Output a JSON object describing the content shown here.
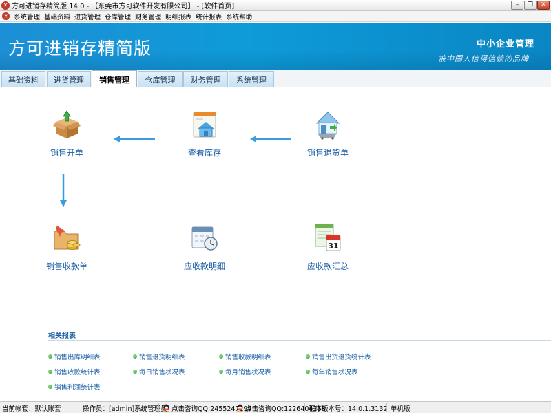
{
  "window": {
    "title": "方可进销存精简版 14.0 - 【东莞市方可软件开发有限公司】 - [软件首页]"
  },
  "menu": [
    "系统管理",
    "基础资料",
    "进货管理",
    "仓库管理",
    "财务管理",
    "明细报表",
    "统计报表",
    "系统帮助"
  ],
  "banner": {
    "title": "方可进销存精简版",
    "slogan_main": "中小企业管理",
    "slogan_sub": "被中国人信得信赖的品牌"
  },
  "tabs": [
    "基础资料",
    "进货管理",
    "销售管理",
    "仓库管理",
    "财务管理",
    "系统管理"
  ],
  "active_tab": "销售管理",
  "modules": {
    "sales_order": "销售开单",
    "stock_view": "查看库存",
    "sales_return": "销售退货单",
    "sales_receipt": "销售收款单",
    "receivable_detail": "应收款明细",
    "receivable_summary": "应收款汇总"
  },
  "reports": {
    "title": "相关报表",
    "items": [
      "销售出库明细表",
      "销售退货明细表",
      "销售收款明细表",
      "销售出货退货统计表",
      "销售收款统计表",
      "每日销售状况表",
      "每月销售状况表",
      "每年销售状况表",
      "销售利润统计表"
    ]
  },
  "status": {
    "account": "当前帐套：默认账套",
    "operator": "操作员：[admin]系统管理员",
    "qq1": "点击咨询QQ:2455247199",
    "qq2": "点击咨询QQ:1226404258",
    "version": "程序版本号：14.0.1.3132",
    "edition": "单机版"
  },
  "colors": {
    "banner": "#0e9bd8",
    "link": "#1a5fa6",
    "arrow": "#3b9ce0"
  }
}
